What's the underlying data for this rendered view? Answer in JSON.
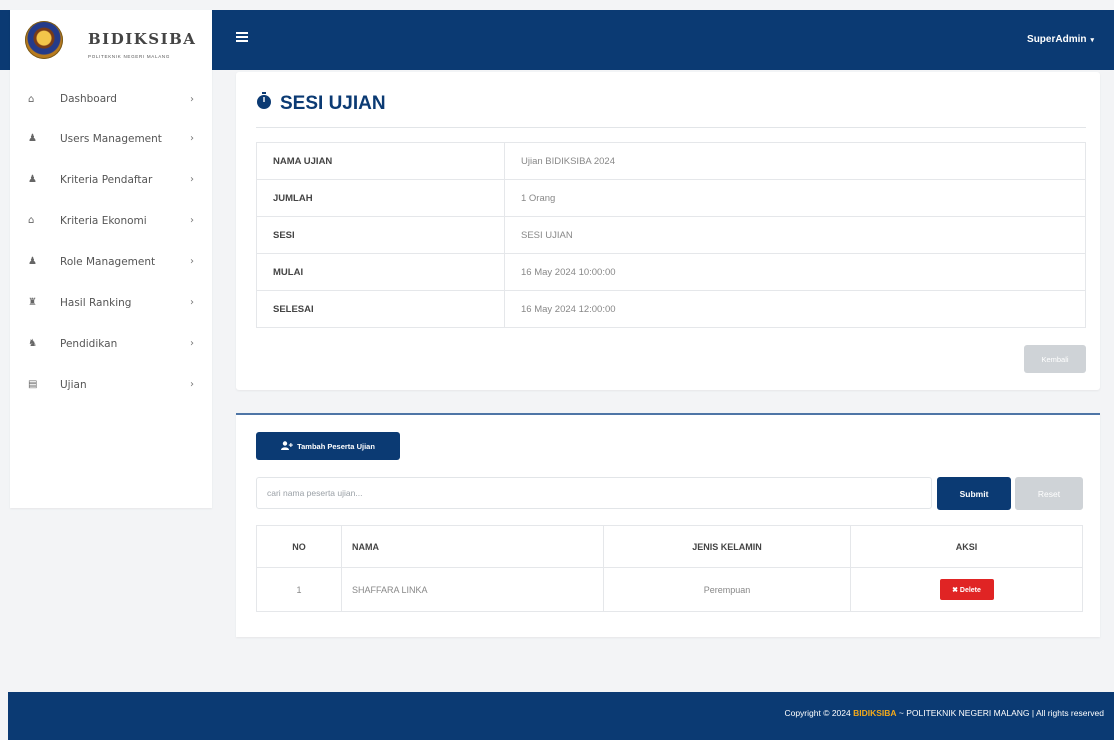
{
  "topbar": {
    "user_label": "SuperAdmin",
    "caret": "▾",
    "color": "#0b3a73"
  },
  "brand": {
    "name": "BIDIKSIBA",
    "subtitle": "POLITEKNIK NEGERI MALANG"
  },
  "sidebar": {
    "items": [
      {
        "label": "Dashboard",
        "icon": "dashboard-icon",
        "glyph": "⌂",
        "arrow": "›"
      },
      {
        "label": "Users Management",
        "icon": "user-icon",
        "glyph": "♟",
        "arrow": "›"
      },
      {
        "label": "Kriteria Pendaftar",
        "icon": "user-icon",
        "glyph": "♟",
        "arrow": "›"
      },
      {
        "label": "Kriteria Ekonomi",
        "icon": "home-icon",
        "glyph": "⌂",
        "arrow": "›"
      },
      {
        "label": "Role Management",
        "icon": "user-group-icon",
        "glyph": "♟",
        "arrow": "›"
      },
      {
        "label": "Hasil Ranking",
        "icon": "trophy-icon",
        "glyph": "♜",
        "arrow": "›"
      },
      {
        "label": "Pendidikan",
        "icon": "graduation-cap-icon",
        "glyph": "♞",
        "arrow": "›"
      },
      {
        "label": "Ujian",
        "icon": "document-icon",
        "glyph": "▤",
        "arrow": "›"
      }
    ]
  },
  "session": {
    "title": "SESI UJIAN",
    "fields": [
      {
        "key": "NAMA UJIAN",
        "value": "Ujian BIDIKSIBA 2024"
      },
      {
        "key": "JUMLAH",
        "value": "1 Orang"
      },
      {
        "key": "SESI",
        "value": "SESI UJIAN"
      },
      {
        "key": "MULAI",
        "value": "16 May 2024 10:00:00"
      },
      {
        "key": "SELESAI",
        "value": "16 May 2024 12:00:00"
      }
    ],
    "back_label": "Kembali"
  },
  "participants": {
    "add_label": "Tambah Peserta Ujian",
    "search_placeholder": "cari nama peserta ujian...",
    "submit_label": "Submit",
    "reset_label": "Reset",
    "columns": [
      "NO",
      "NAMA",
      "JENIS KELAMIN",
      "AKSI"
    ],
    "rows": [
      {
        "no": "1",
        "nama": "SHAFFARA LINKA",
        "jenis_kelamin": "Perempuan",
        "aksi": "✖ Delete"
      }
    ]
  },
  "footer": {
    "prefix": "Copyright © 2024 ",
    "brand": "BIDIKSIBA",
    "suffix": " ~ POLITEKNIK NEGERI MALANG | All rights reserved"
  }
}
